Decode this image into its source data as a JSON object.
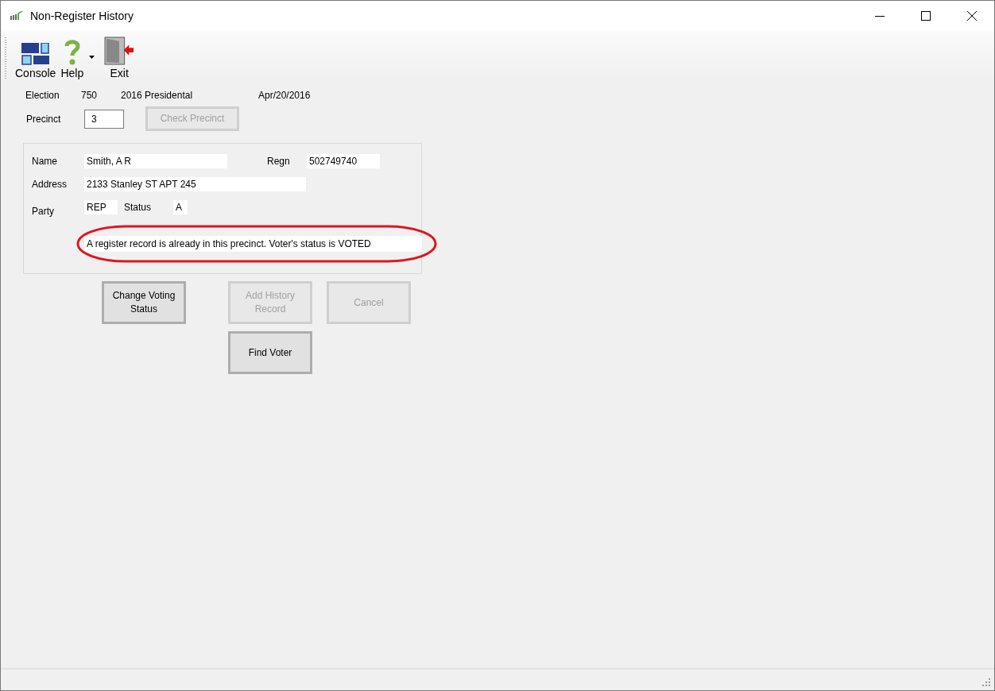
{
  "window": {
    "title": "Non-Register History"
  },
  "toolbar": [
    {
      "kind": "console",
      "label": "Console",
      "dropdown": false
    },
    {
      "kind": "help",
      "label": "Help",
      "dropdown": true
    },
    {
      "kind": "exit",
      "label": "Exit",
      "dropdown": false
    }
  ],
  "election": {
    "label": "Election",
    "number": "750",
    "name": "2016 Presidental",
    "date": "Apr/20/2016"
  },
  "precinct": {
    "label": "Precinct",
    "value": "3",
    "button": {
      "label": "Check Precinct",
      "disabled": true
    }
  },
  "voter": {
    "name_label": "Name",
    "name": "Smith, A R",
    "regn_label": "Regn",
    "regn": "502749740",
    "address_label": "Address",
    "address": "2133 Stanley ST APT 245",
    "party_label": "Party",
    "party": "REP",
    "status_label": "Status",
    "status": "A",
    "message": "A register record is already in this precinct.  Voter's status is VOTED",
    "message_highlighted": true
  },
  "buttons": [
    {
      "label": "Change Voting Status",
      "disabled": false
    },
    {
      "label": "Add History Record",
      "disabled": true
    },
    {
      "label": "Cancel",
      "disabled": true
    },
    {
      "label": "Find Voter",
      "disabled": false
    }
  ]
}
